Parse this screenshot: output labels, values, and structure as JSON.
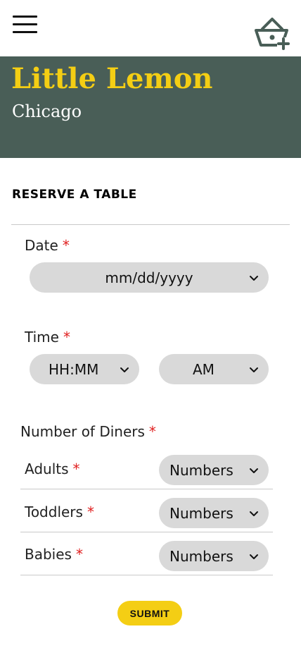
{
  "header": {
    "menu_icon": "hamburger-menu-icon",
    "cart_icon": "basket-add-icon"
  },
  "hero": {
    "brand": "Little Lemon",
    "city": "Chicago"
  },
  "form": {
    "title": "RESERVE A TABLE",
    "required_marker": "*",
    "date": {
      "label": "Date",
      "value": "mm/dd/yyyy"
    },
    "time": {
      "label": "Time",
      "value": "HH:MM",
      "period": "AM"
    },
    "diners": {
      "label": "Number of Diners",
      "rows": [
        {
          "label": "Adults",
          "value": "Numbers"
        },
        {
          "label": "Toddlers",
          "value": "Numbers"
        },
        {
          "label": "Babies",
          "value": "Numbers"
        }
      ]
    },
    "submit_label": "SUBMIT"
  },
  "colors": {
    "brand_yellow": "#f4ce14",
    "brand_green": "#495e57",
    "required_red": "#e02020",
    "field_gray": "#d9d9d9"
  }
}
